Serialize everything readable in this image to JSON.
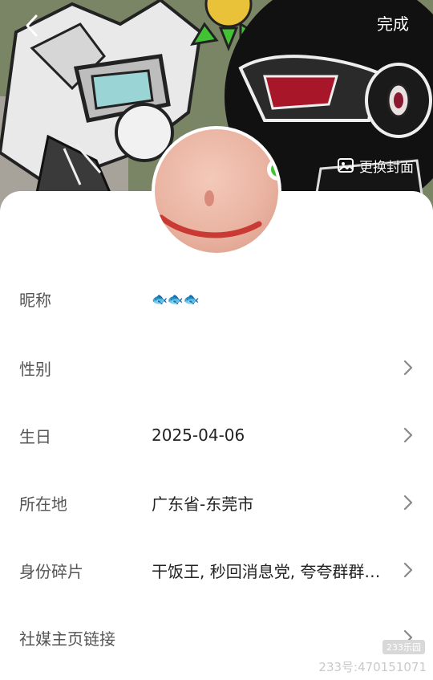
{
  "header": {
    "back_icon": "chevron-left-icon",
    "done_label": "完成",
    "change_cover_label": "更换封面",
    "change_cover_icon": "image-icon"
  },
  "avatar": {
    "description_icon": "avatar-image"
  },
  "fields": [
    {
      "label": "昵称",
      "value": "🐟🐟🐟",
      "has_chevron": false
    },
    {
      "label": "性别",
      "value": "",
      "has_chevron": true
    },
    {
      "label": "生日",
      "value": "2025-04-06",
      "has_chevron": true
    },
    {
      "label": "所在地",
      "value": "广东省-东莞市",
      "has_chevron": true
    },
    {
      "label": "身份碎片",
      "value": "干饭王, 秒回消息党, 夸夸群群…",
      "has_chevron": true
    },
    {
      "label": "社媒主页链接",
      "value": "",
      "has_chevron": true
    }
  ],
  "watermark": {
    "badge": "233乐园",
    "text": "233号:470151071"
  },
  "colors": {
    "accent_red": "#c83a33",
    "sheet_bg": "#ffffff",
    "label_gray": "#555555"
  }
}
